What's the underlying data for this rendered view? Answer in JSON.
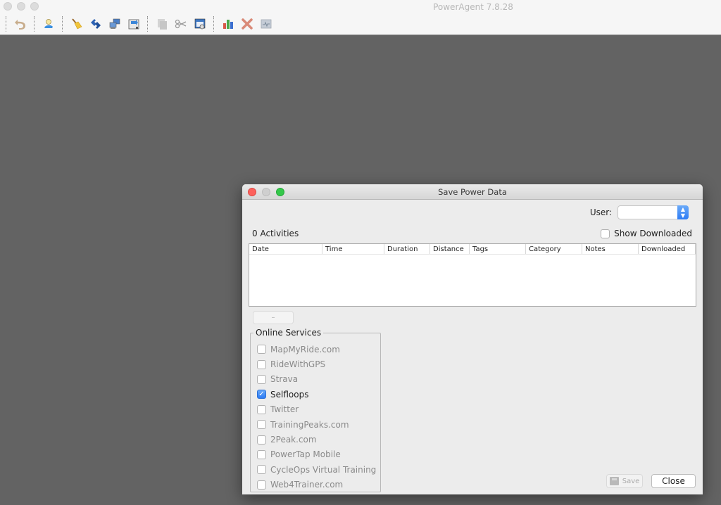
{
  "app": {
    "title": "PowerAgent 7.8.28",
    "toolbar": [
      {
        "icon": "undo-icon",
        "label": "Undo"
      },
      {
        "icon": "user-profile-icon",
        "label": "User"
      },
      {
        "icon": "broom-icon",
        "label": "Clear"
      },
      {
        "icon": "transfer-icon",
        "label": "Transfer"
      },
      {
        "icon": "computers-icon",
        "label": "Devices"
      },
      {
        "icon": "download-icon",
        "label": "Download"
      },
      {
        "icon": "copy-icon",
        "label": "Copy"
      },
      {
        "icon": "scissors-icon",
        "label": "Cut"
      },
      {
        "icon": "window-icon",
        "label": "Window"
      },
      {
        "icon": "bar-chart-icon",
        "label": "Chart"
      },
      {
        "icon": "delete-icon",
        "label": "Delete"
      },
      {
        "icon": "graph-icon",
        "label": "Graph"
      }
    ]
  },
  "dialog": {
    "title": "Save Power Data",
    "user_label": "User:",
    "user_value": "",
    "activities_count": "0 Activities",
    "show_downloaded_label": "Show Downloaded",
    "show_downloaded_checked": false,
    "table": {
      "columns": [
        "Date",
        "Time",
        "Duration",
        "Distance",
        "Tags",
        "Category",
        "Notes",
        "Downloaded"
      ],
      "rows": []
    },
    "remove_button": "–",
    "online_services": {
      "legend": "Online Services",
      "items": [
        {
          "label": "MapMyRide.com",
          "checked": false
        },
        {
          "label": "RideWithGPS",
          "checked": false
        },
        {
          "label": "Strava",
          "checked": false
        },
        {
          "label": "Selfloops",
          "checked": true
        },
        {
          "label": "Twitter",
          "checked": false
        },
        {
          "label": "TrainingPeaks.com",
          "checked": false
        },
        {
          "label": "2Peak.com",
          "checked": false
        },
        {
          "label": "PowerTap Mobile",
          "checked": false
        },
        {
          "label": "CycleOps Virtual Training",
          "checked": false
        },
        {
          "label": "Web4Trainer.com",
          "checked": false
        }
      ]
    },
    "save_button": "Save",
    "close_button": "Close"
  }
}
